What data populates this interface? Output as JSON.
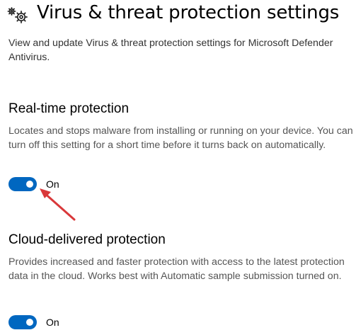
{
  "header": {
    "icon": "gear-pair-icon",
    "title": "Virus & threat protection settings",
    "description": "View and update Virus & threat protection settings for Microsoft Defender Antivirus."
  },
  "sections": [
    {
      "title": "Real-time protection",
      "description": "Locates and stops malware from installing or running on your device. You can turn off this setting for a short time before it turns back on automatically.",
      "toggle_on": true,
      "toggle_label": "On"
    },
    {
      "title": "Cloud-delivered protection",
      "description": "Provides increased and faster protection with access to the latest protection data in the cloud. Works best with Automatic sample submission turned on.",
      "toggle_on": true,
      "toggle_label": "On"
    }
  ],
  "colors": {
    "toggle_accent": "#0067c0",
    "annotation_arrow": "#d9383a"
  }
}
